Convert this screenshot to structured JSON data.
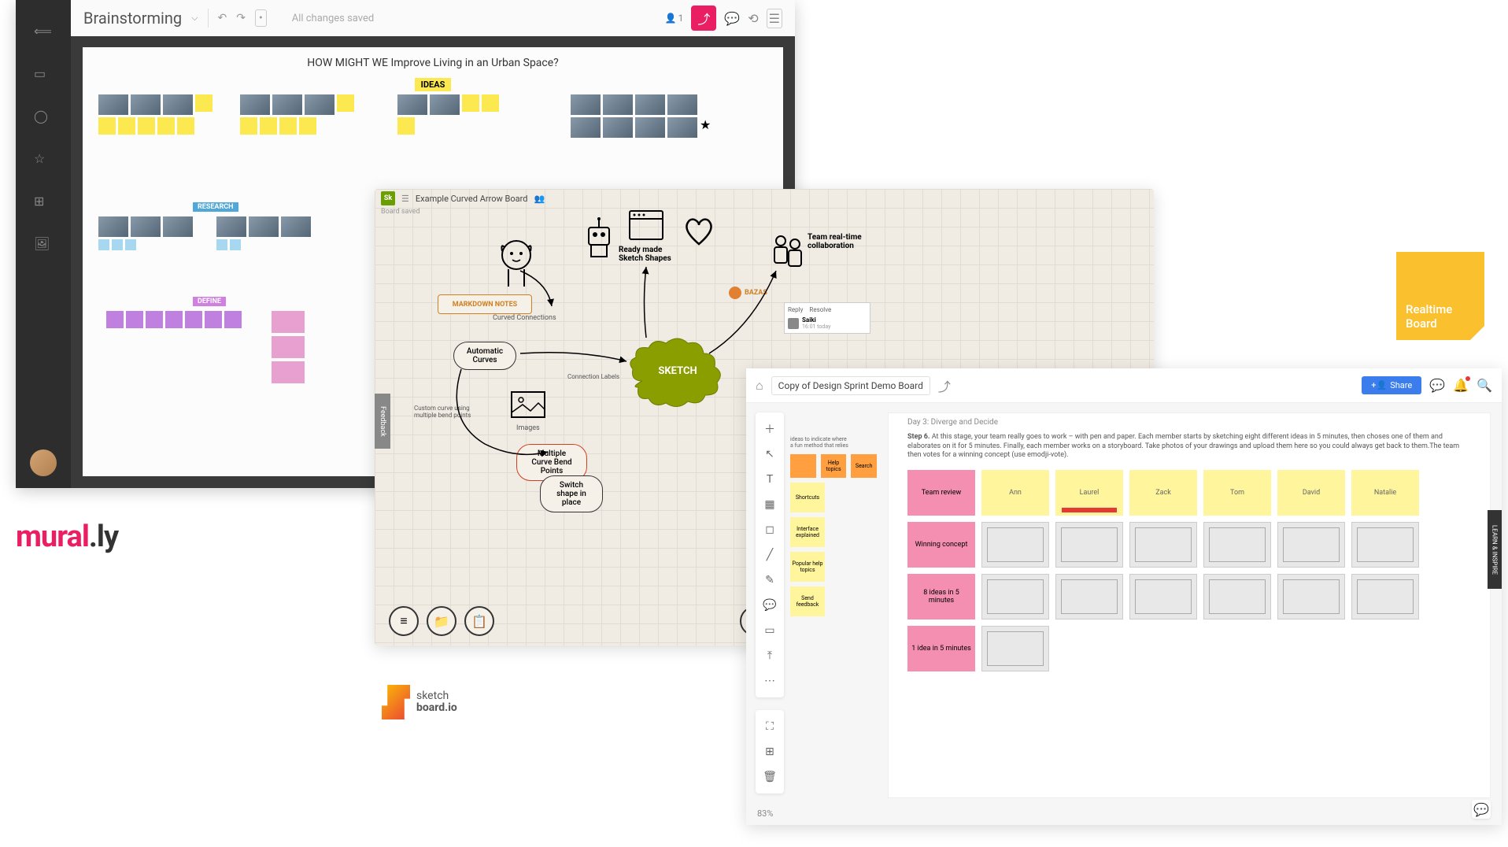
{
  "murally": {
    "title": "Brainstorming",
    "saved_text": "All changes saved",
    "user_count": "1",
    "canvas_title": "HOW MIGHT WE Improve Living in an Urban Space?",
    "ideas_label": "IDEAS",
    "research_label": "RESEARCH",
    "define_label": "DEFINE",
    "logo_text": "mural.ly"
  },
  "sketchboard": {
    "board_name": "Example Curved Arrow Board",
    "saved_text": "Board saved",
    "feedback_label": "Feedback",
    "labels": {
      "markdown": "MARKDOWN NOTES",
      "automatic_curves": "Automatic Curves",
      "curved_connections": "Curved Connections",
      "connection_labels": "Connection Labels",
      "images": "Images",
      "custom_curve": "Custom curve using multiple bend points",
      "multiple_curve": "Multiple Curve Bend Points",
      "switch_shape": "Switch shape in place",
      "ready_made": "Ready made Sketch Shapes",
      "team_realtime": "Team real-time collaboration",
      "sketch": "SKETCH",
      "user_bazas": "BAZAS"
    },
    "comment": {
      "reply": "Reply",
      "resolve": "Resolve",
      "name": "Saiki",
      "time": "16:01 today"
    },
    "logo_text": "sketch\nboard.io"
  },
  "realtimeboard": {
    "board_title": "Copy of Design Sprint Demo Board",
    "share_label": "Share",
    "zoom": "83%",
    "day_label": "Day 3: Diverge and Decide",
    "instructions_prefix": "Step 6.",
    "instructions": "At this stage, your team really goes to work – with pen and paper. Each member starts by sketching eight different ideas in 5 minutes, then choses one of them and elaborates on it for 5 minutes. Finally, each member works on a storyboard. Take photos of your drawings and upload them here so you could always get back to them.The team then votes for a winning concept (use emodji-vote).",
    "columns": [
      "Team review",
      "Ann",
      "Laurel",
      "Zack",
      "Tom",
      "David",
      "Natalie"
    ],
    "rows": [
      "Winning concept",
      "8 ideas in 5 minutes",
      "1 idea in 5 minutes"
    ],
    "panel_stickies": {
      "row1": [
        "ideas to indicate where",
        "a fun method that relies"
      ],
      "row2": [
        "",
        "Help topics",
        "Search"
      ],
      "row3": "Shortcuts",
      "row4": "Interface explained",
      "row5": "Popular help topics",
      "row6": "Send feedback"
    },
    "inspire_label": "LEARN & INSPIRE",
    "logo_text": "Realtime\nBoard"
  }
}
